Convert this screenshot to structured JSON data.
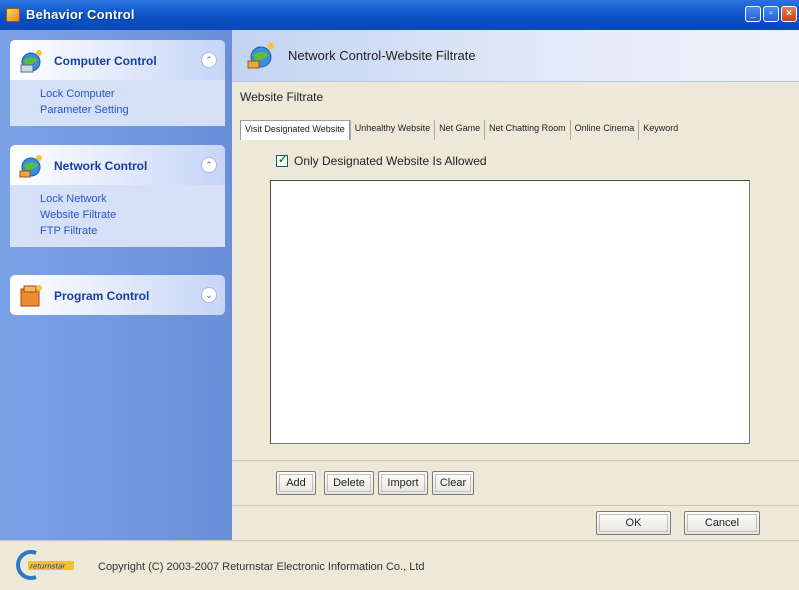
{
  "window": {
    "title": "Behavior Control"
  },
  "sidebar": {
    "groups": [
      {
        "title": "Computer Control",
        "items": [
          "Lock Computer",
          "Parameter Setting"
        ]
      },
      {
        "title": "Network Control",
        "items": [
          "Lock Network",
          "Website Filtrate",
          "FTP Filtrate"
        ]
      },
      {
        "title": "Program Control",
        "items": []
      }
    ]
  },
  "content": {
    "header_title": "Network Control-Website Filtrate",
    "groupbox_label": "Website Filtrate",
    "tabs": [
      {
        "label": "Visit Designated Website",
        "active": true
      },
      {
        "label": "Unhealthy Website",
        "active": false
      },
      {
        "label": "Net Game",
        "active": false
      },
      {
        "label": "Net Chatting Room",
        "active": false
      },
      {
        "label": "Online Cinema",
        "active": false
      },
      {
        "label": "Keyword",
        "active": false
      }
    ],
    "checkbox": {
      "label": "Only Designated Website Is Allowed",
      "checked": true
    },
    "actions": {
      "add": "Add",
      "delete": "Delete",
      "import": "Import",
      "clear": "Clear"
    },
    "dialog": {
      "ok": "OK",
      "cancel": "Cancel"
    }
  },
  "footer": {
    "copyright": "Copyright (C) 2003-2007 Returnstar Electronic Information Co., Ltd",
    "logo_text": "returnstar"
  },
  "colors": {
    "title_bar": "#0b52c7",
    "sidebar_bg": "#7ba2e7",
    "link": "#2a56c6",
    "group_title": "#1a3d9c"
  }
}
